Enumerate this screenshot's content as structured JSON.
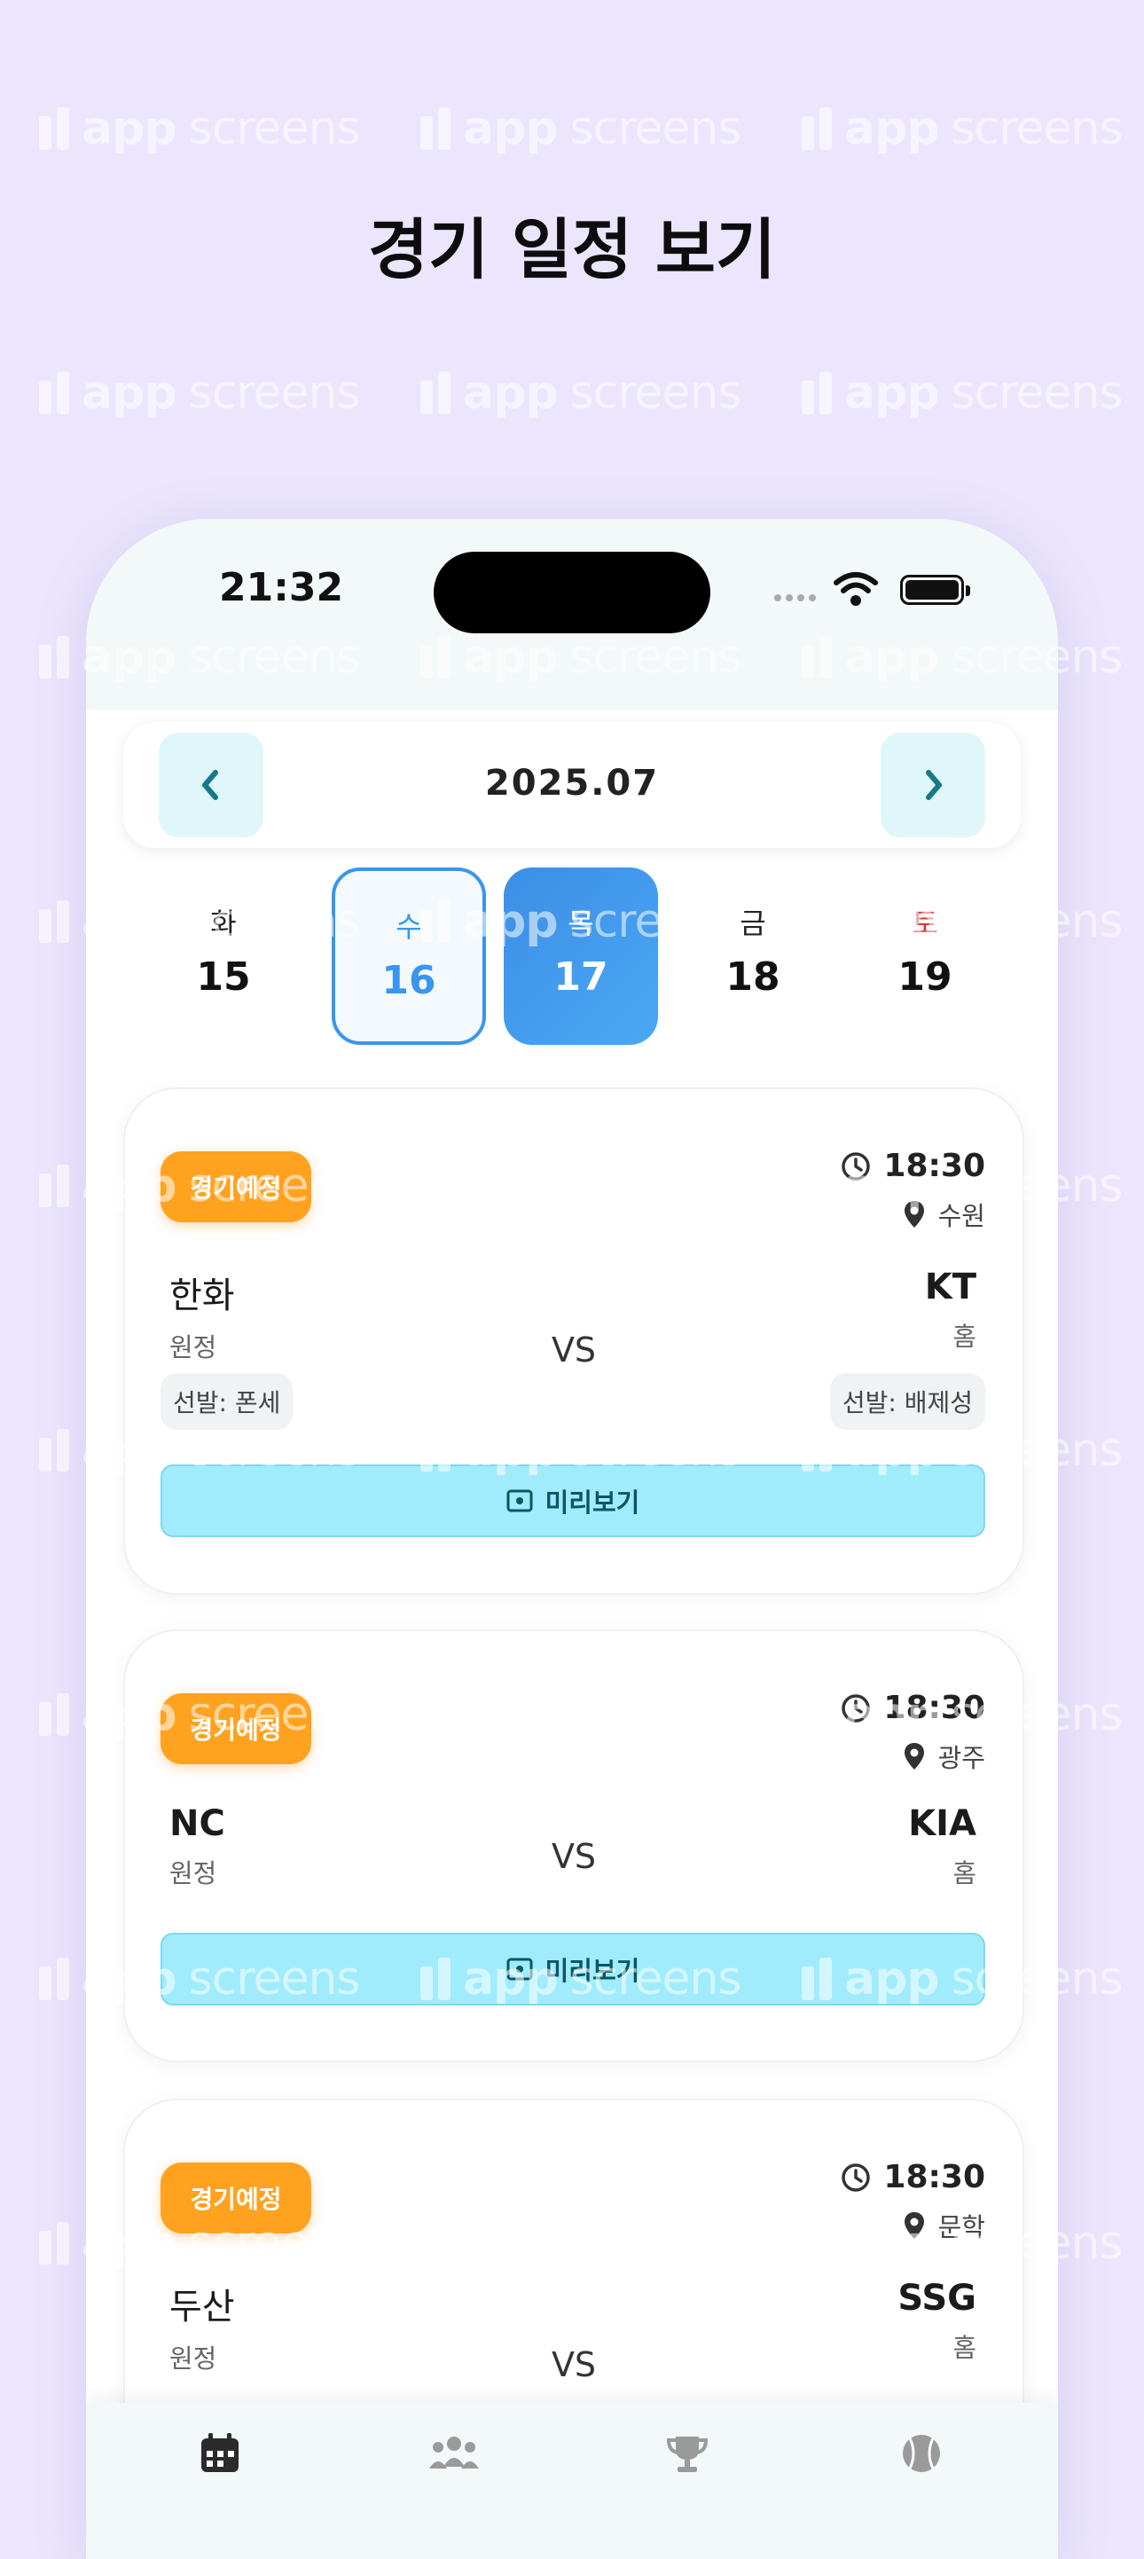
{
  "headline": "경기 일정 보기",
  "watermark": {
    "brand_bold": "app",
    "brand_light": "screens"
  },
  "status_bar": {
    "time": "21:32"
  },
  "calendar": {
    "month": "2025.07",
    "prev_icon": "chevron-left-icon",
    "next_icon": "chevron-right-icon",
    "days": [
      {
        "dow": "화",
        "num": "15",
        "state": "normal"
      },
      {
        "dow": "수",
        "num": "16",
        "state": "selected"
      },
      {
        "dow": "목",
        "num": "17",
        "state": "today"
      },
      {
        "dow": "금",
        "num": "18",
        "state": "normal"
      },
      {
        "dow": "토",
        "num": "19",
        "state": "saturday"
      }
    ]
  },
  "games": [
    {
      "status": "경기예정",
      "time": "18:30",
      "venue": "수원",
      "away": {
        "name": "한화",
        "label": "원정",
        "pitcher": "선발: 폰세"
      },
      "home": {
        "name": "KT",
        "label": "홈",
        "pitcher": "선발: 배제성"
      },
      "vs": "VS",
      "preview_label": "미리보기"
    },
    {
      "status": "경기예정",
      "time": "18:30",
      "venue": "광주",
      "away": {
        "name": "NC",
        "label": "원정"
      },
      "home": {
        "name": "KIA",
        "label": "홈"
      },
      "vs": "VS",
      "preview_label": "미리보기"
    },
    {
      "status": "경기예정",
      "time": "18:30",
      "venue": "문학",
      "away": {
        "name": "두산",
        "label": "원정"
      },
      "home": {
        "name": "SSG",
        "label": "홈"
      },
      "vs": "VS"
    }
  ],
  "bottom_nav": [
    "calendar-icon",
    "team-icon",
    "trophy-icon",
    "baseball-icon"
  ],
  "colors": {
    "accent": "#3a96ec",
    "badge": "#ffa21f",
    "preview": "#a0ecfc",
    "background": "#ebe6fd"
  }
}
